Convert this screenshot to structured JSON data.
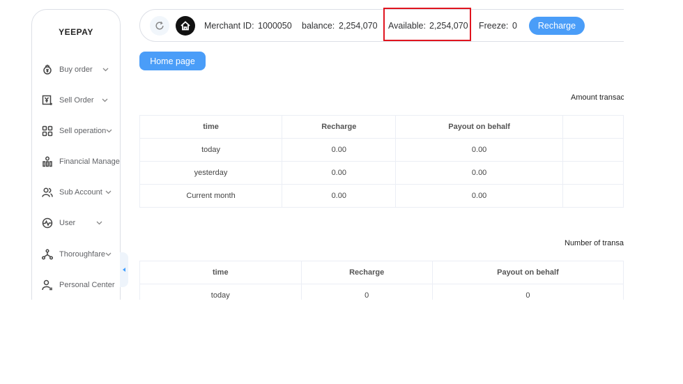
{
  "sidebar": {
    "brand": "YEEPAY",
    "items": [
      {
        "label": "Buy order",
        "icon": "buy-order-icon",
        "has_submenu": true
      },
      {
        "label": "Sell Order",
        "icon": "yen-document-icon",
        "has_submenu": true
      },
      {
        "label": "Sell operation",
        "icon": "grid-icon",
        "has_submenu": true
      },
      {
        "label": "Financial Management",
        "icon": "bar-chart-icon",
        "has_submenu": false
      },
      {
        "label": "Sub Account",
        "icon": "users-icon",
        "has_submenu": true
      },
      {
        "label": "User",
        "icon": "pulse-icon",
        "has_submenu": true
      },
      {
        "label": "Thoroughfare",
        "icon": "network-icon",
        "has_submenu": true
      },
      {
        "label": "Personal Center",
        "icon": "user-card-icon",
        "has_submenu": false
      }
    ]
  },
  "topbar": {
    "merchant_label": "Merchant ID:",
    "merchant_id": "1000050",
    "balance_label": "balance:",
    "balance": "2,254,070",
    "available_label": "Available:",
    "available": "2,254,070",
    "freeze_label": "Freeze:",
    "freeze": "0",
    "recharge_label": "Recharge"
  },
  "home_page_label": "Home page",
  "amount_section": {
    "title": "Amount transacti",
    "columns": [
      "time",
      "Recharge",
      "Payout on behalf",
      ""
    ],
    "rows": [
      [
        "today",
        "0.00",
        "0.00",
        ""
      ],
      [
        "yesterday",
        "0.00",
        "0.00",
        ""
      ],
      [
        "Current month",
        "0.00",
        "0.00",
        ""
      ]
    ]
  },
  "count_section": {
    "title": "Number of transacti",
    "columns": [
      "time",
      "Recharge",
      "Payout on behalf"
    ],
    "rows": [
      [
        "today",
        "0",
        "0"
      ]
    ]
  },
  "colors": {
    "accent": "#4a9df8",
    "highlight_border": "#e0141e",
    "border": "#dcdfe6"
  }
}
